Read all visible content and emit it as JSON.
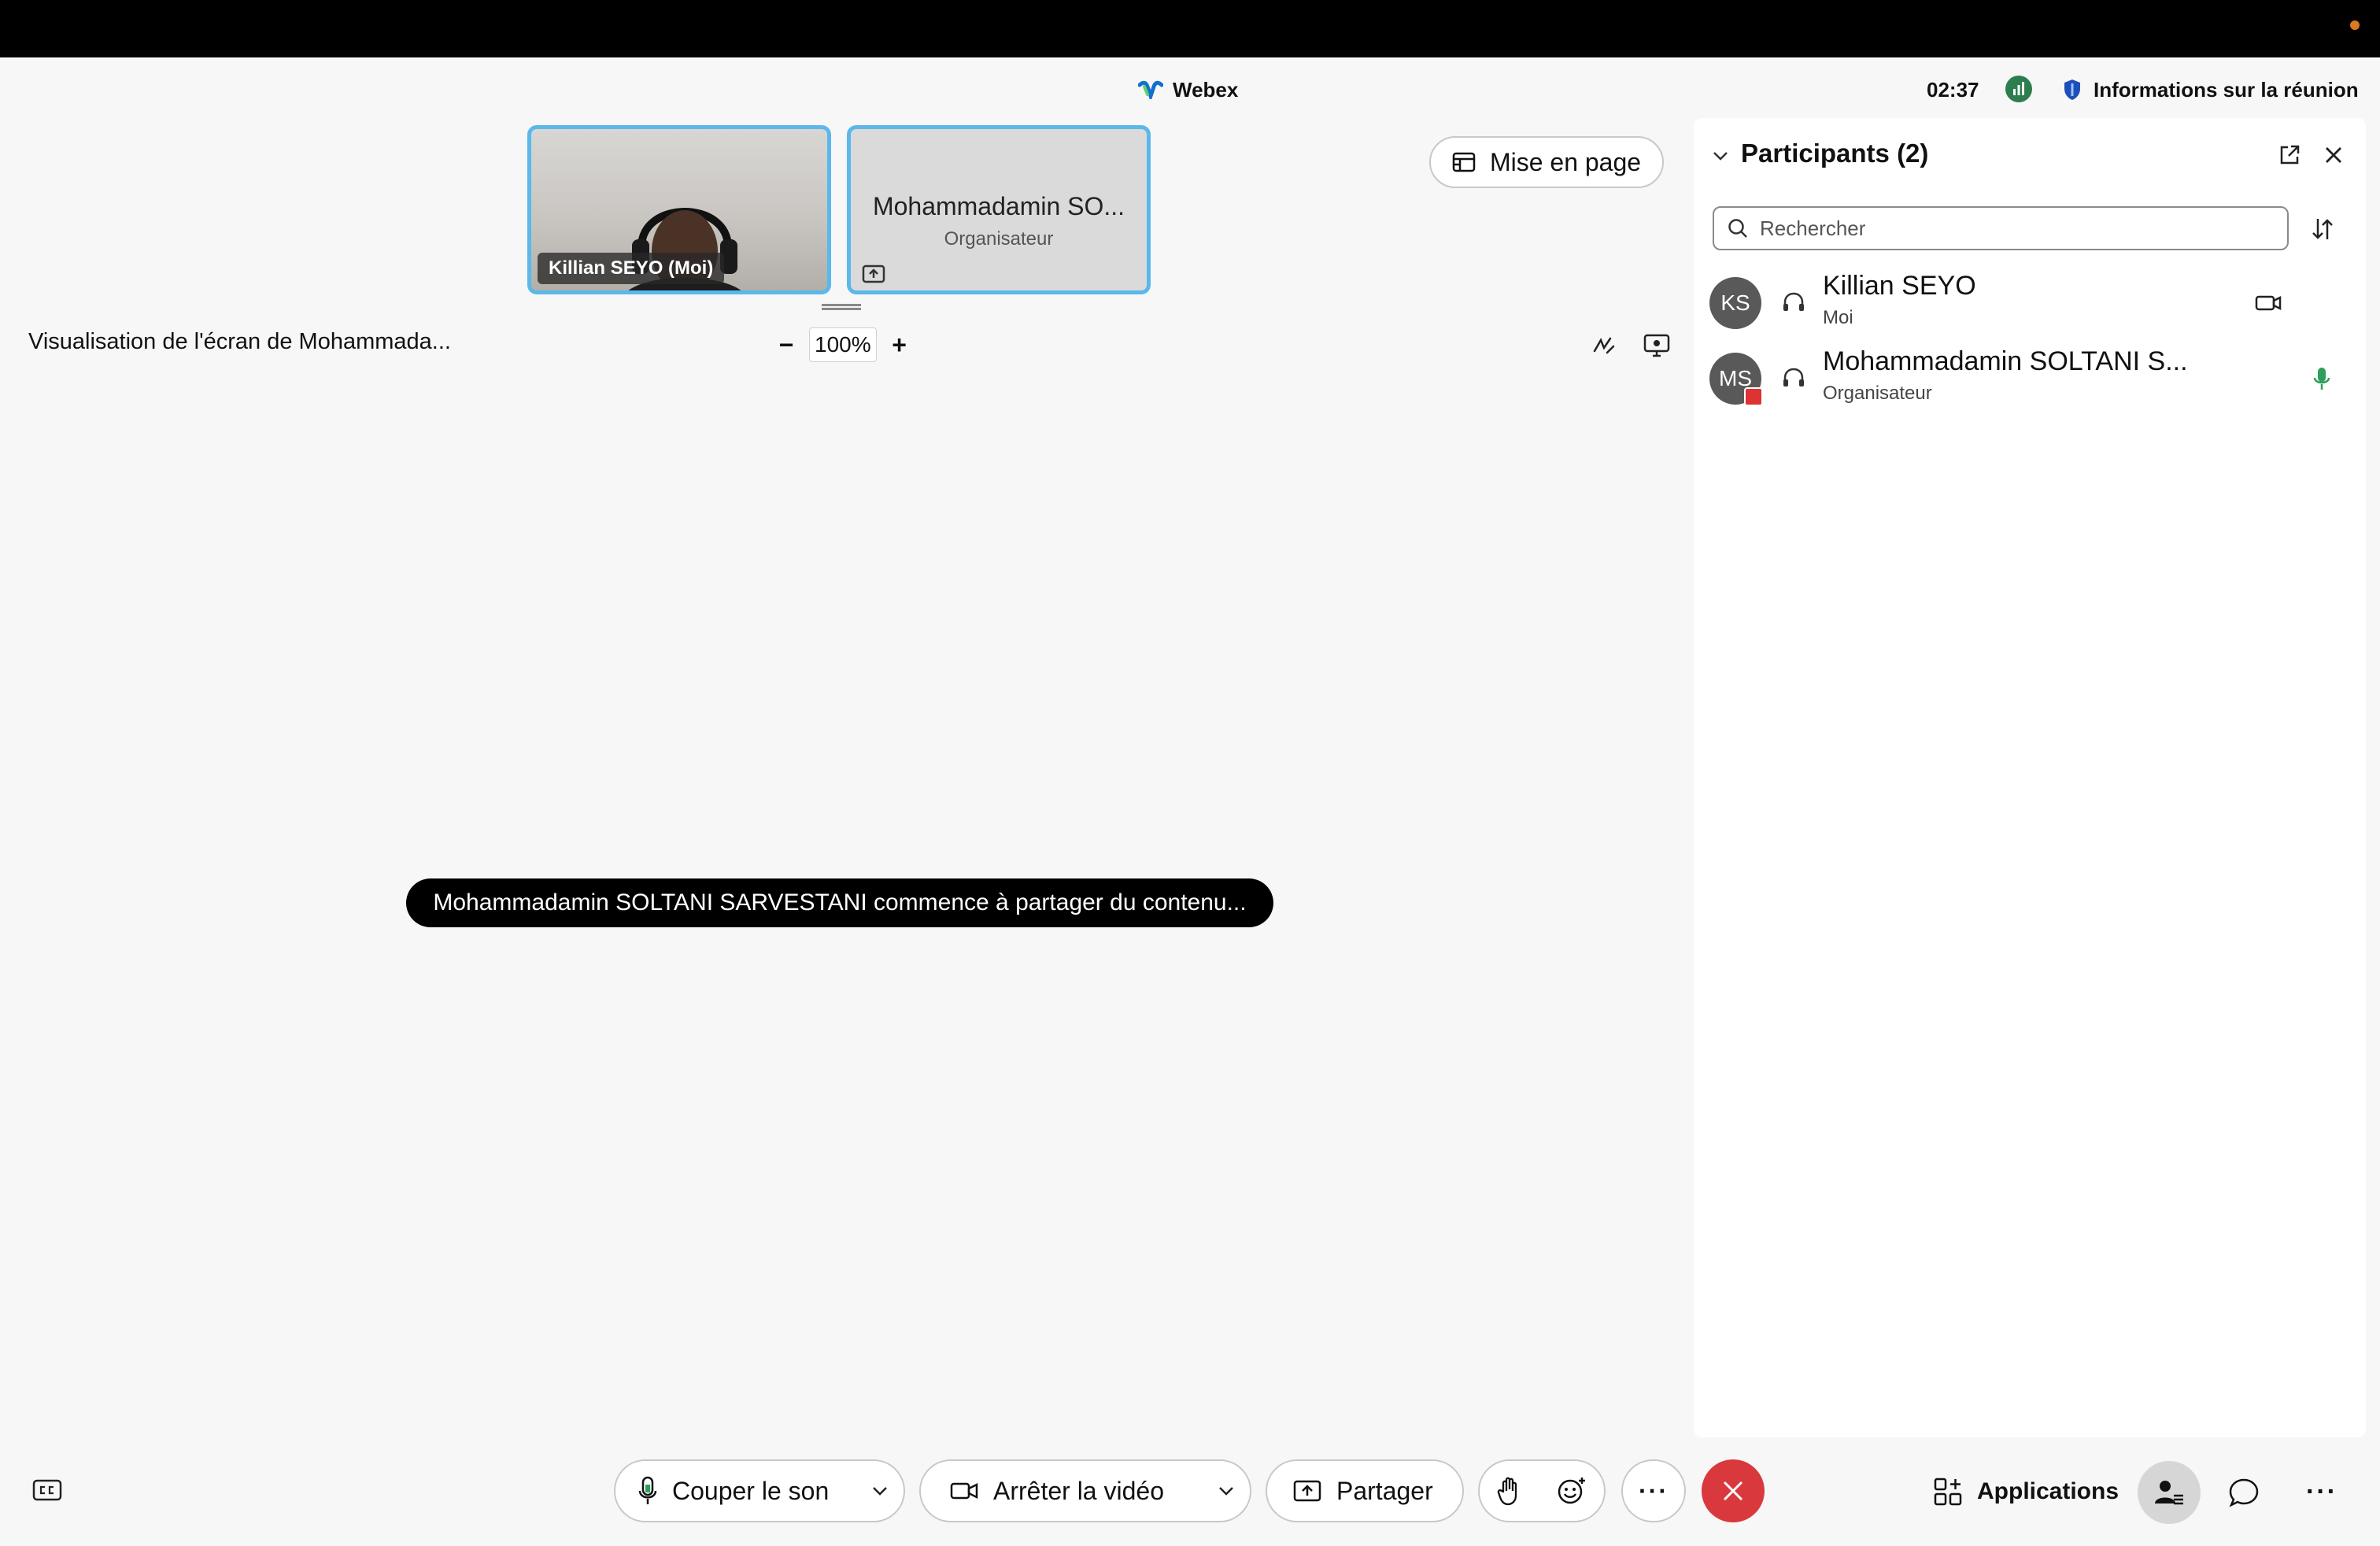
{
  "app": {
    "name": "Webex"
  },
  "status": {
    "time": "02:37",
    "meeting_info_label": "Informations sur la réunion"
  },
  "videos": {
    "self": {
      "name": "Killian SEYO  (Moi)"
    },
    "host": {
      "name": "Mohammadamin SO...",
      "role": "Organisateur"
    }
  },
  "layout_button": {
    "label": "Mise en page"
  },
  "share_view": {
    "title": "Visualisation de l'écran de Mohammada...",
    "zoom_value": "100%",
    "zoom_out": "−",
    "zoom_in": "+",
    "toast": "Mohammadamin SOLTANI SARVESTANI commence à partager du contenu..."
  },
  "participants_panel": {
    "title": "Participants (2)",
    "search_placeholder": "Rechercher",
    "participants": [
      {
        "initials": "KS",
        "name": "Killian SEYO",
        "subtitle": "Moi",
        "status_icon": "video-icon"
      },
      {
        "initials": "MS",
        "name": "Mohammadamin SOLTANI S...",
        "subtitle": "Organisateur",
        "status_icon": "mic-active-icon"
      }
    ]
  },
  "controls": {
    "mute_label": "Couper le son",
    "video_label": "Arrêter la vidéo",
    "share_label": "Partager",
    "more_label": "···",
    "apps_label": "Applications",
    "more_right_label": "···"
  },
  "colors": {
    "accent": "#5ab8ea",
    "leave": "#d9393c",
    "mic_active": "#2e9e5b"
  }
}
